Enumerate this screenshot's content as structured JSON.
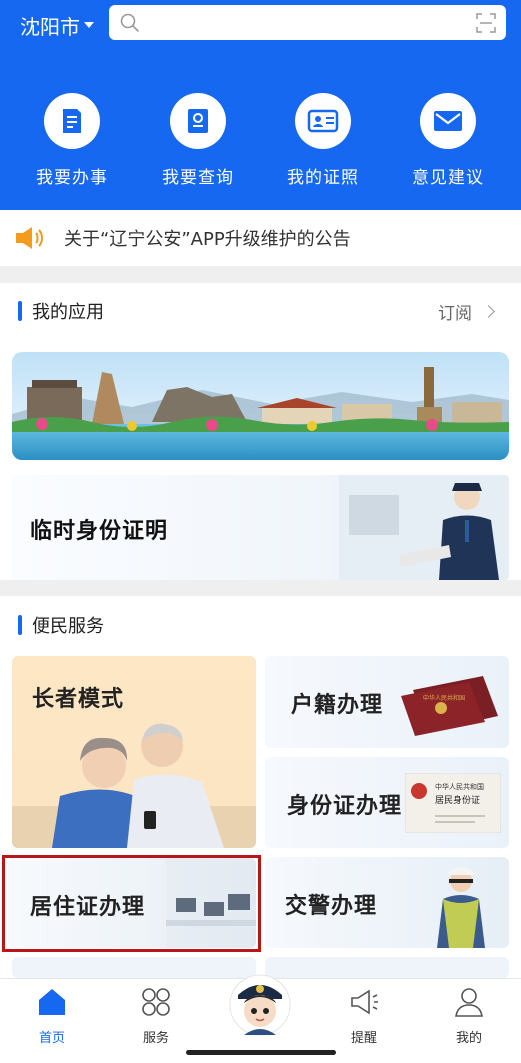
{
  "header": {
    "city": "沈阳市",
    "quick_actions": [
      {
        "label": "我要办事",
        "icon": "document-icon"
      },
      {
        "label": "我要查询",
        "icon": "search-doc-icon"
      },
      {
        "label": "我的证照",
        "icon": "id-card-icon"
      },
      {
        "label": "意见建议",
        "icon": "mail-icon"
      }
    ]
  },
  "notice": {
    "text": "关于“辽宁公安”APP升级维护的公告"
  },
  "my_apps": {
    "title": "我的应用",
    "subscribe": "订阅"
  },
  "temp_id": {
    "title": "临时身份证明"
  },
  "services": {
    "title": "便民服务",
    "elder_mode": "长者模式",
    "household": "户籍办理",
    "id_card": "身份证办理",
    "residence": "居住证办理",
    "traffic": "交警办理",
    "passport_text": "中华人民共和国",
    "idcard_text_1": "中华人民共和国",
    "idcard_text_2": "居民身份证"
  },
  "tabbar": {
    "items": [
      {
        "label": "首页",
        "icon": "home-icon",
        "active": true
      },
      {
        "label": "服务",
        "icon": "grid-icon",
        "active": false
      },
      {
        "label": "提醒",
        "icon": "megaphone-icon",
        "active": false
      },
      {
        "label": "我的",
        "icon": "user-icon",
        "active": false
      }
    ]
  },
  "colors": {
    "primary": "#1668f0",
    "highlight": "#b8161a"
  }
}
